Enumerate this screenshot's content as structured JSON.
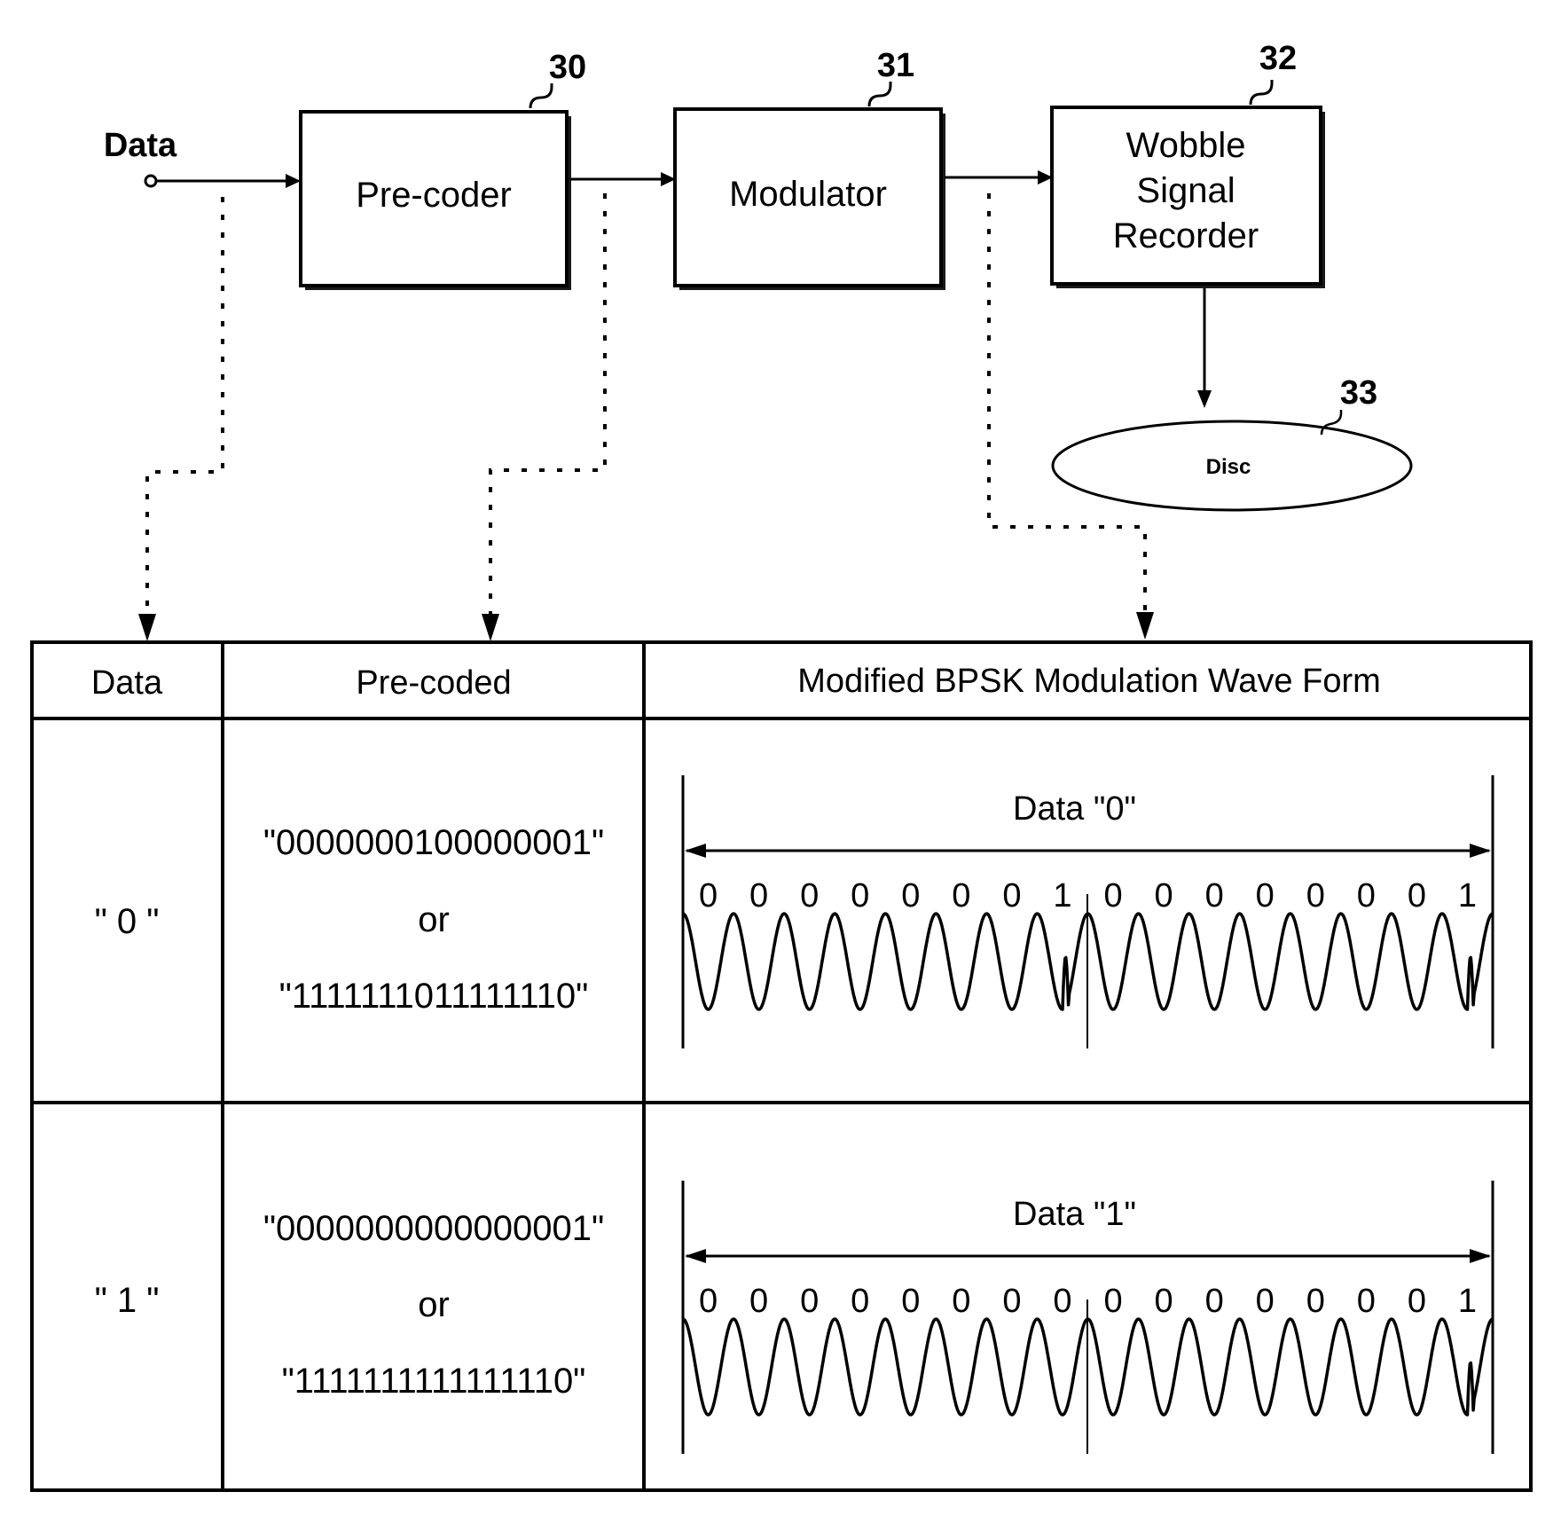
{
  "diagram": {
    "input_label": "Data",
    "blocks": [
      {
        "id": "precoder",
        "ref": "30",
        "lines": [
          "Pre-coder"
        ]
      },
      {
        "id": "modulator",
        "ref": "31",
        "lines": [
          "Modulator"
        ]
      },
      {
        "id": "wobble-recorder",
        "ref": "32",
        "lines": [
          "Wobble",
          "Signal",
          "Recorder"
        ]
      }
    ],
    "disc": {
      "ref": "33",
      "label": "Disc"
    }
  },
  "table": {
    "headers": [
      "Data",
      "Pre-coded",
      "Modified BPSK Modulation Wave Form"
    ],
    "rows": [
      {
        "data": "\" 0 \"",
        "precoded": [
          "\"0000000100000001\"",
          "or",
          "\"1111111011111110\""
        ],
        "wave_title": "Data \"0\"",
        "bits": [
          "0",
          "0",
          "0",
          "0",
          "0",
          "0",
          "0",
          "1",
          "0",
          "0",
          "0",
          "0",
          "0",
          "0",
          "0",
          "1"
        ]
      },
      {
        "data": "\" 1 \"",
        "precoded": [
          "\"0000000000000001\"",
          "or",
          "\"1111111111111110\""
        ],
        "wave_title": "Data \"1\"",
        "bits": [
          "0",
          "0",
          "0",
          "0",
          "0",
          "0",
          "0",
          "0",
          "0",
          "0",
          "0",
          "0",
          "0",
          "0",
          "0",
          "1"
        ]
      }
    ]
  }
}
